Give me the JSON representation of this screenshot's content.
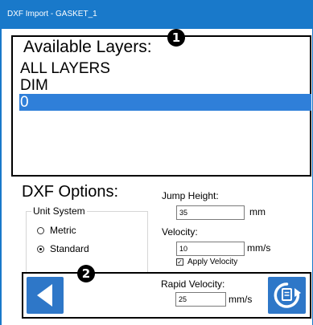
{
  "window": {
    "title": "DXF Import - GASKET_1"
  },
  "layers": {
    "heading": "Available Layers:",
    "badge": "1",
    "items": [
      {
        "label": "ALL LAYERS",
        "selected": false
      },
      {
        "label": "DIM",
        "selected": false
      },
      {
        "label": "0",
        "selected": true
      }
    ]
  },
  "options": {
    "heading": "DXF Options:",
    "unit_system": {
      "legend": "Unit System",
      "metric_label": "Metric",
      "standard_label": "Standard",
      "selected": "Standard"
    },
    "jump_height": {
      "label": "Jump Height:",
      "value": "35",
      "unit": "mm"
    },
    "velocity": {
      "label": "Velocity:",
      "value": "10",
      "unit": "mm/s"
    },
    "apply_velocity": {
      "label": "Apply Velocity",
      "checked": true
    }
  },
  "navigation": {
    "badge": "2",
    "rapid_velocity": {
      "label": "Rapid Velocity:",
      "value": "25",
      "unit": "mm/s"
    },
    "back_icon": "triangle-left-icon",
    "apply_icon": "refresh-document-icon"
  },
  "colors": {
    "titlebar": "#1979ca",
    "selection": "#2f7fd9",
    "button": "#2e77c8"
  }
}
